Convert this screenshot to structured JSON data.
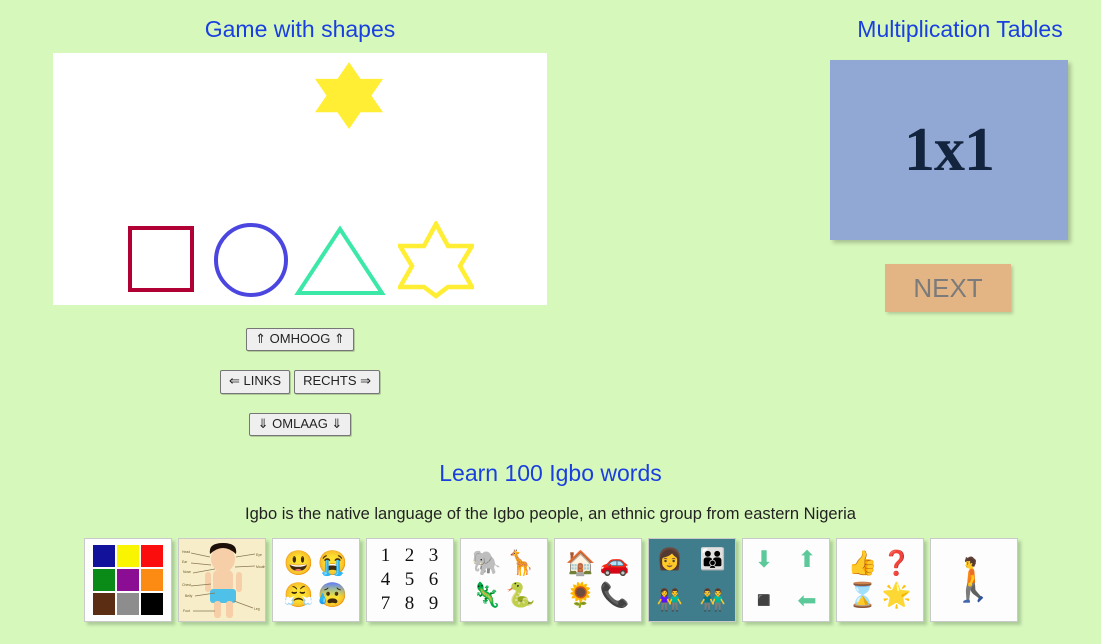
{
  "page": {
    "background_color": "#d7f8bb",
    "heading_color": "#1a3fe0"
  },
  "shapes_game": {
    "title": "Game with shapes",
    "canvas": {
      "background_color": "#ffffff",
      "moving_piece": {
        "name": "star-filled",
        "color": "#ffee33",
        "points": 6
      },
      "targets": [
        {
          "name": "square",
          "color": "#b00034"
        },
        {
          "name": "circle",
          "color": "#4b46e0"
        },
        {
          "name": "triangle",
          "color": "#3ce8a8"
        },
        {
          "name": "star",
          "color": "#ffee33"
        }
      ]
    },
    "controls": {
      "up": "⇑ OMHOOG ⇑",
      "left": "⇐ LINKS",
      "right": "RECHTS ⇒",
      "down": "⇓ OMLAAG ⇓"
    }
  },
  "multiplication": {
    "title": "Multiplication Tables",
    "board_value": "1x1",
    "board_color": "#92a8d4",
    "next_label": "NEXT",
    "next_color": "#e3b584"
  },
  "igbo": {
    "title": "Learn 100 Igbo words",
    "subtitle": "Igbo is the native language of the Igbo people, an ethnic group from eastern Nigeria",
    "tiles": [
      {
        "name": "colors",
        "kind": "swatches",
        "colors": [
          "#12119c",
          "#f9f501",
          "#fc0d0d",
          "#0a8a16",
          "#8a0d93",
          "#fb8b12",
          "#5b2d12",
          "#8d8d8d",
          "#000000"
        ]
      },
      {
        "name": "body-parts",
        "kind": "image",
        "caption": "body diagram"
      },
      {
        "name": "feelings",
        "kind": "glyphs",
        "glyphs": [
          "😃",
          "😭",
          "😤",
          "😰"
        ]
      },
      {
        "name": "numbers",
        "kind": "numbers",
        "values": [
          "1",
          "2",
          "3",
          "4",
          "5",
          "6",
          "7",
          "8",
          "9"
        ]
      },
      {
        "name": "animals",
        "kind": "glyphs",
        "glyphs": [
          "🐘",
          "🦒",
          "🦎",
          "🐍"
        ]
      },
      {
        "name": "things",
        "kind": "glyphs",
        "glyphs": [
          "🏠",
          "🚗",
          "🌻",
          "📞"
        ]
      },
      {
        "name": "people",
        "kind": "people",
        "glyphs": [
          "👩",
          "👪",
          "👫",
          "👬"
        ]
      },
      {
        "name": "positions",
        "kind": "prepositions",
        "glyphs": [
          "⬇",
          "⬆",
          "◾",
          "⬅"
        ]
      },
      {
        "name": "adjectives",
        "kind": "glyphs",
        "glyphs": [
          "👍",
          "❓",
          "⌛",
          "🌟"
        ]
      },
      {
        "name": "verbs",
        "kind": "single",
        "glyphs": [
          "🚶"
        ]
      }
    ]
  }
}
